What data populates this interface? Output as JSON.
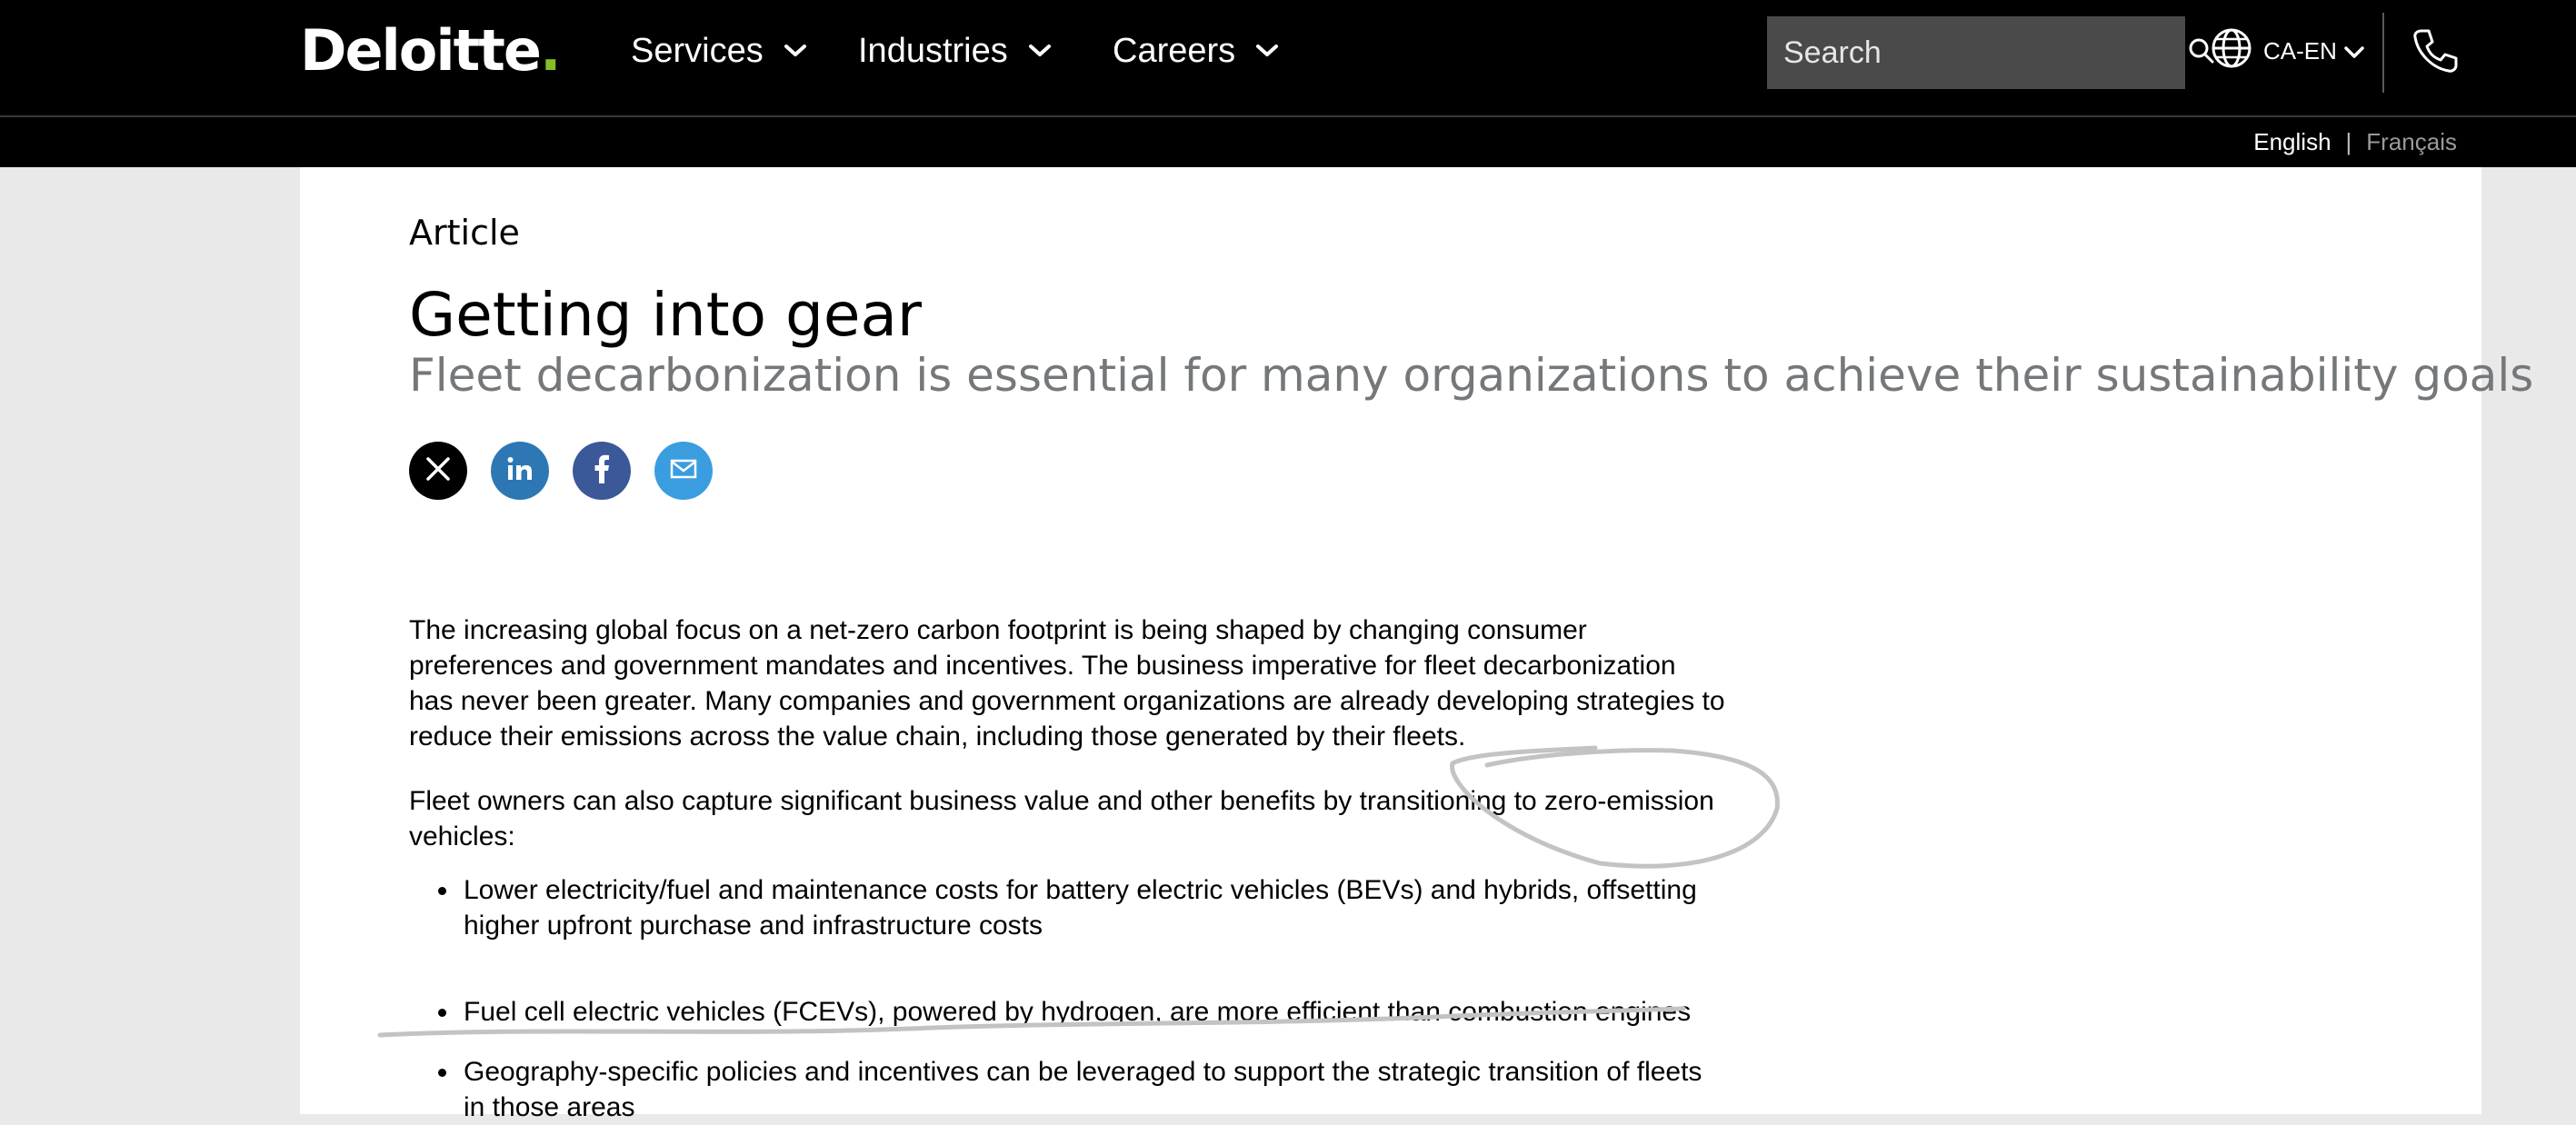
{
  "header": {
    "logo_text": "Deloitte",
    "logo_dot": ".",
    "brand_accent": "#86bc25",
    "nav": [
      {
        "label": "Services",
        "icon": "chevron-down-icon"
      },
      {
        "label": "Industries",
        "icon": "chevron-down-icon"
      },
      {
        "label": "Careers",
        "icon": "chevron-down-icon"
      }
    ],
    "search_placeholder": "Search",
    "search_icon": "search-icon",
    "locale_label": "CA-EN",
    "locale_icon": "globe-icon",
    "phone_icon": "phone-icon"
  },
  "language_bar": {
    "english": "English",
    "separator": "|",
    "french": "Français"
  },
  "article": {
    "eyebrow": "Article",
    "title": "Getting into gear",
    "subtitle": "Fleet decarbonization is essential for many organizations to achieve their sustainability goals",
    "share": [
      "x-icon",
      "linkedin-icon",
      "facebook-icon",
      "email-icon"
    ],
    "share_colors": {
      "x": "#000000",
      "linkedin": "#2d78b4",
      "facebook": "#3b5998",
      "email": "#3a9de0"
    },
    "paragraph_1": "The increasing global focus on a net-zero carbon footprint is being shaped by changing consumer preferences and government mandates and incentives. The business imperative for fleet decarbonization has never been greater. Many companies and government organizations are already developing strategies to reduce their emissions across the value chain, including those generated by their fleets.",
    "paragraph_2": "Fleet owners can also capture significant business value and other benefits by transitioning to zero-emission vehicles:",
    "bullets": [
      "Lower electricity/fuel and maintenance costs for battery electric vehicles (BEVs) and hybrids, offsetting higher upfront purchase and infrastructure costs",
      "Fuel cell electric vehicles (FCEVs), powered by hydrogen, are more efficient than combustion engines",
      "Geography-specific policies and incentives can be leveraged to support the strategic transition of fleets in those areas"
    ]
  },
  "annotation_color": "#c3c3c3"
}
